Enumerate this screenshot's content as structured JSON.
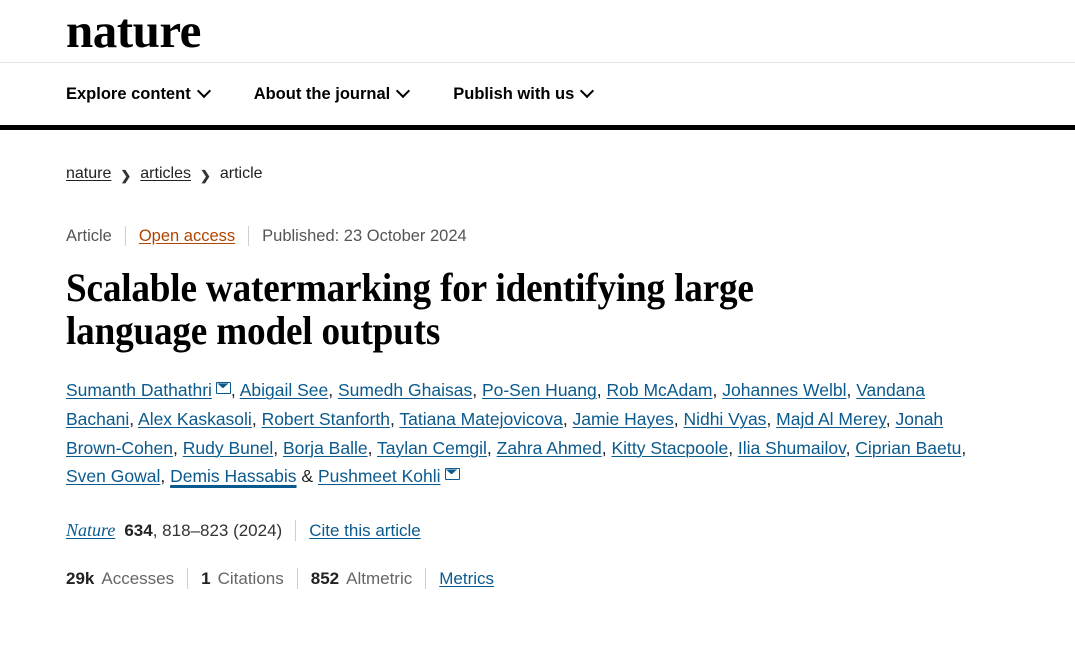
{
  "header": {
    "logo_text": "nature",
    "nav_items": [
      {
        "label": "Explore content",
        "icon": "chevron-down-icon"
      },
      {
        "label": "About the journal",
        "icon": "chevron-down-icon"
      },
      {
        "label": "Publish with us",
        "icon": "chevron-down-icon"
      }
    ]
  },
  "breadcrumb": {
    "items": [
      {
        "label": "nature",
        "is_link": true
      },
      {
        "label": "articles",
        "is_link": true
      },
      {
        "label": "article",
        "is_link": false
      }
    ],
    "separator": "❯"
  },
  "article": {
    "type_label": "Article",
    "access_label": "Open access",
    "published_label": "Published: 23 October 2024",
    "title": "Scalable watermarking for identifying large language model outputs",
    "authors": [
      {
        "name": "Sumanth Dathathri",
        "corresponding": true,
        "hovered": false
      },
      {
        "name": "Abigail See",
        "corresponding": false,
        "hovered": false
      },
      {
        "name": "Sumedh Ghaisas",
        "corresponding": false,
        "hovered": false
      },
      {
        "name": "Po-Sen Huang",
        "corresponding": false,
        "hovered": false
      },
      {
        "name": "Rob McAdam",
        "corresponding": false,
        "hovered": false
      },
      {
        "name": "Johannes Welbl",
        "corresponding": false,
        "hovered": false
      },
      {
        "name": "Vandana Bachani",
        "corresponding": false,
        "hovered": false
      },
      {
        "name": "Alex Kaskasoli",
        "corresponding": false,
        "hovered": false
      },
      {
        "name": "Robert Stanforth",
        "corresponding": false,
        "hovered": false
      },
      {
        "name": "Tatiana Matejovicova",
        "corresponding": false,
        "hovered": false
      },
      {
        "name": "Jamie Hayes",
        "corresponding": false,
        "hovered": false
      },
      {
        "name": "Nidhi Vyas",
        "corresponding": false,
        "hovered": false
      },
      {
        "name": "Majd Al Merey",
        "corresponding": false,
        "hovered": false
      },
      {
        "name": "Jonah Brown-Cohen",
        "corresponding": false,
        "hovered": false
      },
      {
        "name": "Rudy Bunel",
        "corresponding": false,
        "hovered": false
      },
      {
        "name": "Borja Balle",
        "corresponding": false,
        "hovered": false
      },
      {
        "name": "Taylan Cemgil",
        "corresponding": false,
        "hovered": false
      },
      {
        "name": "Zahra Ahmed",
        "corresponding": false,
        "hovered": false
      },
      {
        "name": "Kitty Stacpoole",
        "corresponding": false,
        "hovered": false
      },
      {
        "name": "Ilia Shumailov",
        "corresponding": false,
        "hovered": false
      },
      {
        "name": "Ciprian Baetu",
        "corresponding": false,
        "hovered": false
      },
      {
        "name": "Sven Gowal",
        "corresponding": false,
        "hovered": false
      },
      {
        "name": "Demis Hassabis",
        "corresponding": false,
        "hovered": true
      },
      {
        "name": "Pushmeet Kohli",
        "corresponding": true,
        "hovered": false,
        "last": true
      }
    ],
    "author_separator": ", ",
    "author_last_separator": " & ",
    "corresponding_icon": "envelope-icon",
    "citation": {
      "journal": "Nature",
      "volume": "634",
      "pages_year": ", 818–823 (2024)",
      "cite_link_label": "Cite this article"
    },
    "metrics": [
      {
        "value": "29k",
        "label": "Accesses"
      },
      {
        "value": "1",
        "label": "Citations"
      },
      {
        "value": "852",
        "label": "Altmetric"
      }
    ],
    "metrics_link_label": "Metrics"
  },
  "colors": {
    "link_blue": "#0b5a8e",
    "open_access_orange": "#b04500",
    "rule_black": "#000000",
    "muted_text": "#666666"
  }
}
